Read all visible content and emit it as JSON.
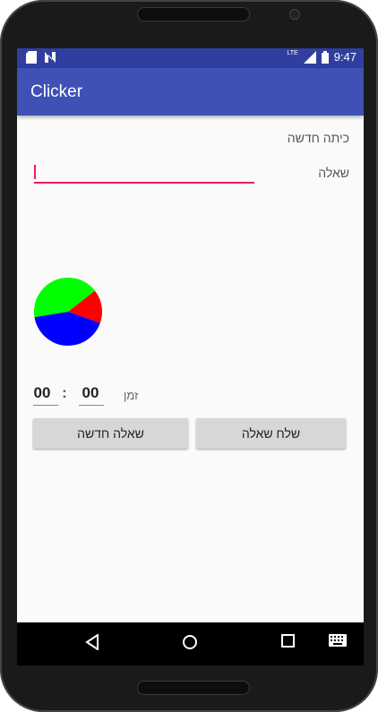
{
  "status_bar": {
    "time": "9:47",
    "network": "LTE",
    "icons": [
      "sd-card-icon",
      "notification-n-icon",
      "signal-icon",
      "battery-icon"
    ]
  },
  "app_bar": {
    "title": "Clicker"
  },
  "form": {
    "new_class_label": "כיתה חדשה",
    "question_label": "שאלה",
    "question_value": ""
  },
  "pie_chart": {
    "slices": [
      {
        "color": "#00ff00",
        "fraction": 0.42
      },
      {
        "color": "#ff0000",
        "fraction": 0.16
      },
      {
        "color": "#0000ff",
        "fraction": 0.42
      }
    ]
  },
  "timer": {
    "label": "זמן",
    "minutes": "00",
    "separator": ":",
    "seconds": "00"
  },
  "buttons": {
    "send_question": "שלח שאלה",
    "new_question": "שאלה חדשה"
  },
  "nav": {
    "icons": [
      "back-icon",
      "home-icon",
      "recents-icon",
      "keyboard-icon"
    ]
  }
}
